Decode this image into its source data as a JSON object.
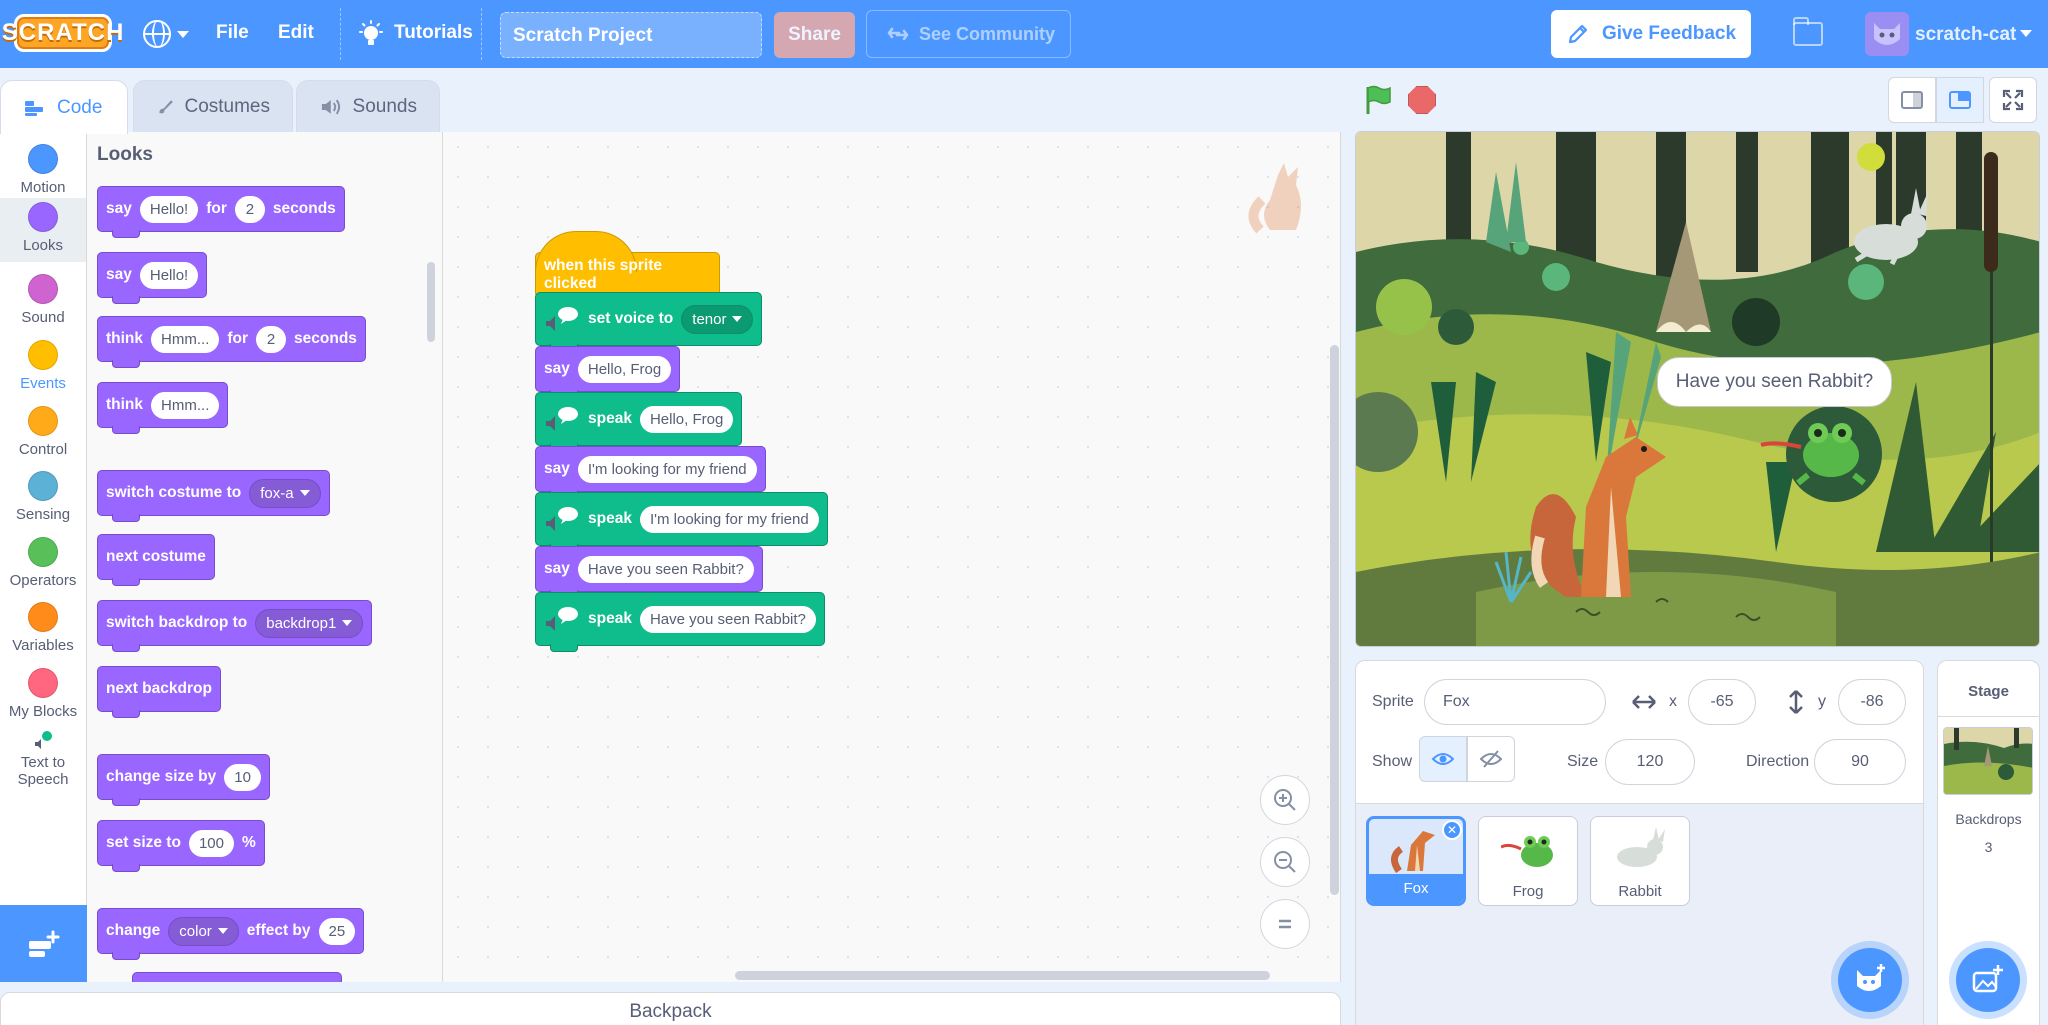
{
  "menu": {
    "logo": "SCRATCH",
    "file": "File",
    "edit": "Edit",
    "tutorials": "Tutorials",
    "project_title": "Scratch Project",
    "share": "Share",
    "see_community": "See Community",
    "give_feedback": "Give Feedback",
    "username": "scratch-cat"
  },
  "tabs": {
    "code": "Code",
    "costumes": "Costumes",
    "sounds": "Sounds"
  },
  "categories": [
    {
      "label": "Motion",
      "color": "#4c97ff"
    },
    {
      "label": "Looks",
      "color": "#9966ff"
    },
    {
      "label": "Sound",
      "color": "#cf63cf"
    },
    {
      "label": "Events",
      "color": "#ffbf00"
    },
    {
      "label": "Control",
      "color": "#ffab19"
    },
    {
      "label": "Sensing",
      "color": "#5cb1d6"
    },
    {
      "label": "Operators",
      "color": "#59c059"
    },
    {
      "label": "Variables",
      "color": "#ff8c1a"
    },
    {
      "label": "My Blocks",
      "color": "#ff6680"
    }
  ],
  "tts_category": "Text to Speech",
  "palette": {
    "title": "Looks",
    "say_for": {
      "a": "say",
      "v1": "Hello!",
      "b": "for",
      "v2": "2",
      "c": "seconds"
    },
    "say": {
      "a": "say",
      "v1": "Hello!"
    },
    "think_for": {
      "a": "think",
      "v1": "Hmm...",
      "b": "for",
      "v2": "2",
      "c": "seconds"
    },
    "think": {
      "a": "think",
      "v1": "Hmm..."
    },
    "switch_costume": {
      "a": "switch costume to",
      "v1": "fox-a"
    },
    "next_costume": "next costume",
    "switch_backdrop": {
      "a": "switch backdrop to",
      "v1": "backdrop1"
    },
    "next_backdrop": "next backdrop",
    "change_size": {
      "a": "change size by",
      "v1": "10"
    },
    "set_size": {
      "a": "set size to",
      "v1": "100",
      "b": "%"
    },
    "change_effect": {
      "a": "change",
      "v1": "color",
      "b": "effect by",
      "v2": "25"
    }
  },
  "script": {
    "hat": "when this sprite clicked",
    "set_voice": {
      "label": "set voice to",
      "value": "tenor"
    },
    "say1": {
      "label": "say",
      "value": "Hello, Frog"
    },
    "speak1": {
      "label": "speak",
      "value": "Hello, Frog"
    },
    "say2": {
      "label": "say",
      "value": "I'm looking for my friend"
    },
    "speak2": {
      "label": "speak",
      "value": "I'm looking for my friend"
    },
    "say3": {
      "label": "say",
      "value": "Have you seen Rabbit?"
    },
    "speak3": {
      "label": "speak",
      "value": "Have you seen Rabbit?"
    }
  },
  "backpack": "Backpack",
  "stage": {
    "speech": "Have you seen Rabbit?"
  },
  "sprite_info": {
    "sprite_label": "Sprite",
    "sprite_name": "Fox",
    "x_label": "x",
    "x": "-65",
    "y_label": "y",
    "y": "-86",
    "show_label": "Show",
    "size_label": "Size",
    "size": "120",
    "direction_label": "Direction",
    "direction": "90"
  },
  "sprites": [
    {
      "name": "Fox",
      "selected": true
    },
    {
      "name": "Frog",
      "selected": false
    },
    {
      "name": "Rabbit",
      "selected": false
    }
  ],
  "stage_pane": {
    "title": "Stage",
    "backdrops_label": "Backdrops",
    "backdrops_count": "3"
  },
  "colors": {
    "accent": "#4c97ff",
    "looks": "#9966ff",
    "events": "#ffbf00",
    "extension": "#0fbd8c"
  }
}
